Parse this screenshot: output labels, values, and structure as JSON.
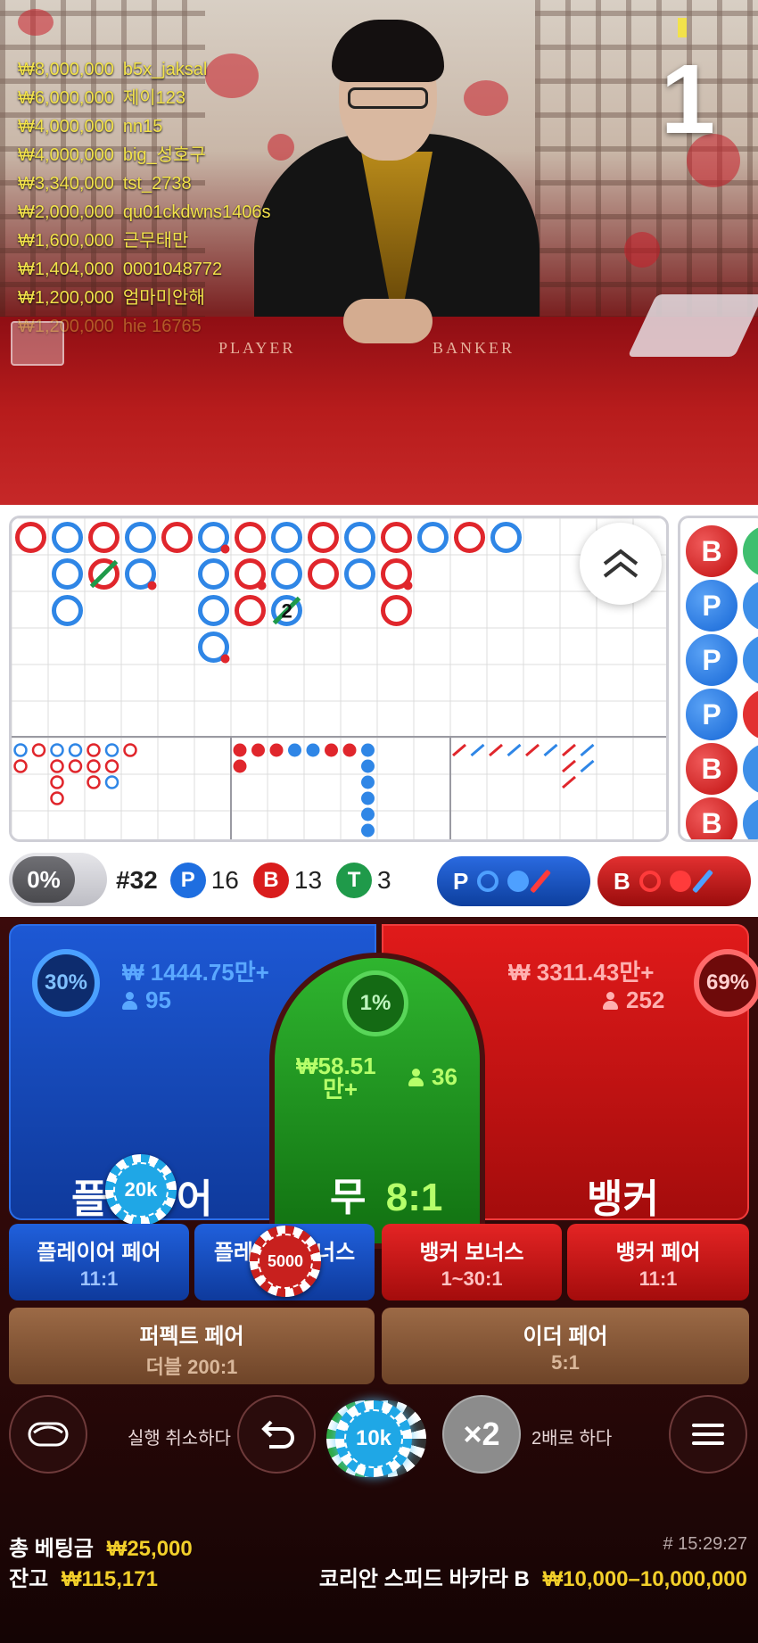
{
  "stream": {
    "round_timer": "1",
    "felt_labels": {
      "player": "PLAYER",
      "banker": "BANKER"
    },
    "winners": [
      {
        "amount": "₩8,000,000",
        "name": "b5x_jaksal"
      },
      {
        "amount": "₩6,000,000",
        "name": "제이123"
      },
      {
        "amount": "₩4,000,000",
        "name": "nn15"
      },
      {
        "amount": "₩4,000,000",
        "name": "big_성호구"
      },
      {
        "amount": "₩3,340,000",
        "name": "tst_2738"
      },
      {
        "amount": "₩2,000,000",
        "name": "qu01ckdwns1406s"
      },
      {
        "amount": "₩1,600,000",
        "name": "근무태만"
      },
      {
        "amount": "₩1,404,000",
        "name": "0001048772"
      },
      {
        "amount": "₩1,200,000",
        "name": "엄마미안해"
      },
      {
        "amount": "₩1,200,000",
        "name": "hie 16765"
      }
    ]
  },
  "roadmap": {
    "big_road_cols": [
      [
        {
          "c": "B"
        }
      ],
      [
        {
          "c": "P"
        },
        {
          "c": "P"
        },
        {
          "c": "P"
        }
      ],
      [
        {
          "c": "B"
        },
        {
          "c": "B",
          "tie": 1
        }
      ],
      [
        {
          "c": "P"
        },
        {
          "c": "P",
          "pair": "B"
        }
      ],
      [
        {
          "c": "B"
        }
      ],
      [
        {
          "c": "P",
          "pair": "B"
        },
        {
          "c": "P"
        },
        {
          "c": "P"
        },
        {
          "c": "P",
          "pair": "B"
        }
      ],
      [
        {
          "c": "B"
        },
        {
          "c": "B",
          "pair": "B"
        },
        {
          "c": "B"
        }
      ],
      [
        {
          "c": "P"
        },
        {
          "c": "P"
        },
        {
          "c": "P",
          "tie": 2
        }
      ],
      [
        {
          "c": "B"
        },
        {
          "c": "B"
        }
      ],
      [
        {
          "c": "P"
        },
        {
          "c": "P"
        }
      ],
      [
        {
          "c": "B"
        },
        {
          "c": "B",
          "pair": "B"
        },
        {
          "c": "B"
        }
      ],
      [
        {
          "c": "P"
        }
      ],
      [
        {
          "c": "B"
        }
      ],
      [
        {
          "c": "P"
        }
      ]
    ],
    "tie_label": "2",
    "bead_plate_visible": [
      "B",
      "P",
      "P",
      "P",
      "B",
      "B"
    ],
    "bead_peek_colors": [
      "#3fbf6f",
      "#3e8fe8",
      "#3e8fe8",
      "#e23030",
      "#3e8fe8",
      "#3e8fe8"
    ]
  },
  "stats": {
    "percent_toggle": "0%",
    "round_number": "#32",
    "player_letter": "P",
    "player_count": "16",
    "banker_letter": "B",
    "banker_count": "13",
    "tie_letter": "T",
    "tie_count": "3",
    "predict_player_letter": "P",
    "predict_banker_letter": "B",
    "colors": {
      "player": "#1e6ee0",
      "banker": "#d91c1c",
      "tie": "#1f9a4a"
    }
  },
  "bets": {
    "player": {
      "label_start": "플",
      "label_end": "어",
      "pct": "30%",
      "amount": "₩ 1444.75만+",
      "players": "95"
    },
    "banker": {
      "label": "뱅커",
      "pct": "69%",
      "amount": "₩ 3311.43만+",
      "players": "252"
    },
    "tie": {
      "label": "무",
      "odds": "8:1",
      "pct": "1%",
      "amount_line1": "₩58.51",
      "amount_line2": "만+",
      "players": "36"
    },
    "chips_on_table": {
      "player_chip": "20k",
      "player_bonus_chip": "5000"
    },
    "side": [
      {
        "title": "플레이어 페어",
        "odds": "11:1"
      },
      {
        "title": "플레이어 보너스",
        "odds": ""
      },
      {
        "title": "뱅커 보너스",
        "odds": "1~30:1"
      },
      {
        "title": "뱅커 페어",
        "odds": "11:1"
      }
    ],
    "player_bonus_visible_start": "플레",
    "player_bonus_visible_end": "너스",
    "perfect_pair": {
      "title": "퍼펙트 페어",
      "odds": "더블 200:1"
    },
    "either_pair": {
      "title": "이더 페어",
      "odds": "5:1"
    }
  },
  "controls": {
    "undo_label": "실행 취소하다",
    "selected_chip": "10k",
    "double_symbol": "×2",
    "double_label": "2배로 하다"
  },
  "footer": {
    "total_bet_label": "총 베팅금",
    "total_bet_value": "₩25,000",
    "balance_label": "잔고",
    "balance_value": "₩115,171",
    "round_time": "# 15:29:27",
    "table_name": "코리안 스피드 바카라 B",
    "limits": "₩10,000–10,000,000"
  }
}
